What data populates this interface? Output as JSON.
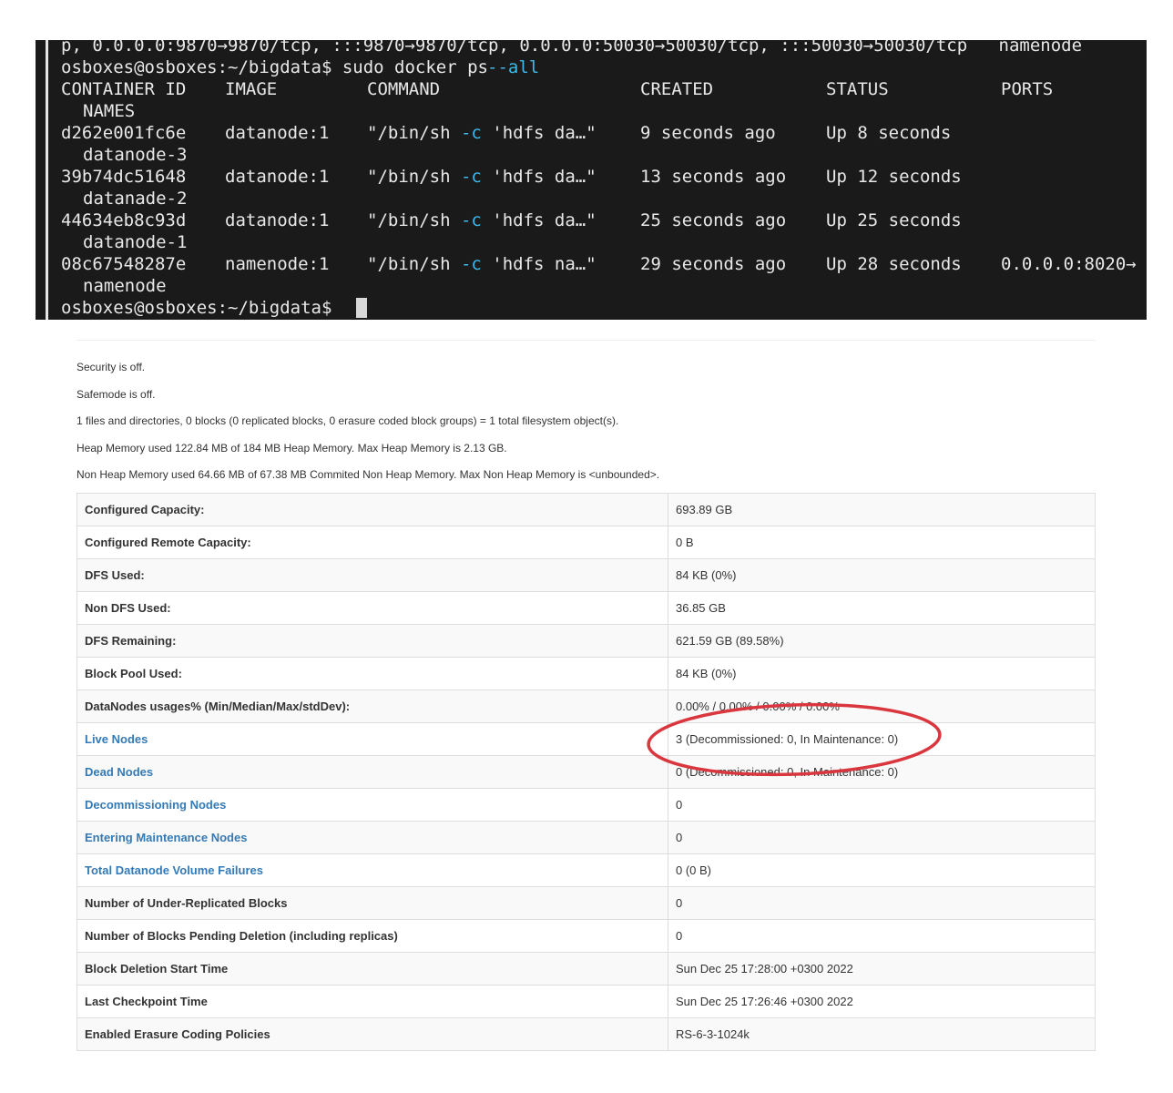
{
  "terminal": {
    "line_top": "p, 0.0.0.0:9870→9870/tcp, :::9870→9870/tcp, 0.0.0.0:50030→50030/tcp, :::50030→50030/tcp   namenode",
    "prompt1": "osboxes@osboxes:~/bigdata$ sudo docker ps ",
    "prompt1_flag": "--all",
    "headers": {
      "id": "CONTAINER ID",
      "image": "IMAGE",
      "command": "COMMAND",
      "created": "CREATED",
      "status": "STATUS",
      "ports": "PORTS",
      "names": "NAMES"
    },
    "rows": [
      {
        "id": "d262e001fc6e",
        "image": "datanode:1",
        "cmd_a": "\"/bin/sh ",
        "cmd_flag": "-c",
        "cmd_b": " 'hdfs da…\"",
        "created": "9 seconds ago",
        "status": "Up 8 seconds",
        "ports": "",
        "name": "datanode-3"
      },
      {
        "id": "39b74dc51648",
        "image": "datanode:1",
        "cmd_a": "\"/bin/sh ",
        "cmd_flag": "-c",
        "cmd_b": " 'hdfs da…\"",
        "created": "13 seconds ago",
        "status": "Up 12 seconds",
        "ports": "",
        "name": "datanade-2"
      },
      {
        "id": "44634eb8c93d",
        "image": "datanode:1",
        "cmd_a": "\"/bin/sh ",
        "cmd_flag": "-c",
        "cmd_b": " 'hdfs da…\"",
        "created": "25 seconds ago",
        "status": "Up 25 seconds",
        "ports": "",
        "name": "datanode-1"
      },
      {
        "id": "08c67548287e",
        "image": "namenode:1",
        "cmd_a": "\"/bin/sh ",
        "cmd_flag": "-c",
        "cmd_b": " 'hdfs na…\"",
        "created": "29 seconds ago",
        "status": "Up 28 seconds",
        "ports": "0.0.0.0:8020→",
        "name": "namenode"
      }
    ],
    "prompt2": "osboxes@osboxes:~/bigdata$ "
  },
  "status": [
    "Security is off.",
    "Safemode is off.",
    "1 files and directories, 0 blocks (0 replicated blocks, 0 erasure coded block groups) = 1 total filesystem object(s).",
    "Heap Memory used 122.84 MB of 184 MB Heap Memory. Max Heap Memory is 2.13 GB.",
    "Non Heap Memory used 64.66 MB of 67.38 MB Commited Non Heap Memory. Max Non Heap Memory is <unbounded>."
  ],
  "summary": [
    {
      "key": "Configured Capacity:",
      "value": "693.89 GB"
    },
    {
      "key": "Configured Remote Capacity:",
      "value": "0 B"
    },
    {
      "key": "DFS Used:",
      "value": "84 KB (0%)"
    },
    {
      "key": "Non DFS Used:",
      "value": "36.85 GB"
    },
    {
      "key": "DFS Remaining:",
      "value": "621.59 GB (89.58%)"
    },
    {
      "key": "Block Pool Used:",
      "value": "84 KB (0%)"
    },
    {
      "key": "DataNodes usages% (Min/Median/Max/stdDev):",
      "value": "0.00% / 0.00% / 0.00% / 0.00%"
    },
    {
      "key": "Live Nodes",
      "value": "3 (Decommissioned: 0, In Maintenance: 0)"
    },
    {
      "key": "Dead Nodes",
      "value": "0 (Decommissioned: 0, In Maintenance: 0)"
    },
    {
      "key": "Decommissioning Nodes",
      "value": "0"
    },
    {
      "key": "Entering Maintenance Nodes",
      "value": "0"
    },
    {
      "key": "Total Datanode Volume Failures",
      "value": "0 (0 B)"
    },
    {
      "key": "Number of Under-Replicated Blocks",
      "value": "0"
    },
    {
      "key": "Number of Blocks Pending Deletion (including replicas)",
      "value": "0"
    },
    {
      "key": "Block Deletion Start Time",
      "value": "Sun Dec 25 17:28:00 +0300 2022"
    },
    {
      "key": "Last Checkpoint Time",
      "value": "Sun Dec 25 17:26:46 +0300 2022"
    },
    {
      "key": "Enabled Erasure Coding Policies",
      "value": "RS-6-3-1024k"
    }
  ],
  "colors": {
    "link": "#337ab7",
    "annotation": "#d9363e",
    "terminal_bg": "#1a1a1a",
    "terminal_flag": "#3fb7e8"
  }
}
